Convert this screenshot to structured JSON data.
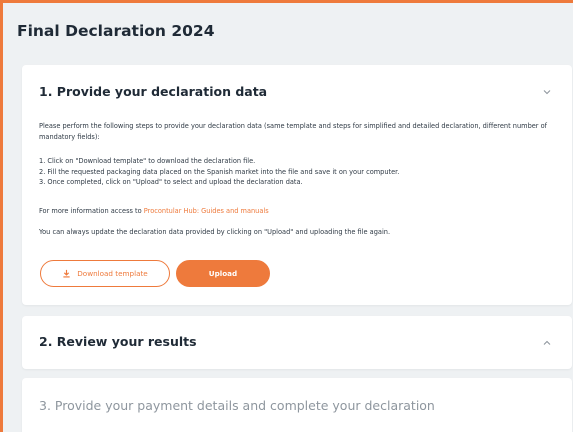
{
  "page": {
    "title": "Final Declaration 2024"
  },
  "colors": {
    "accent": "#ee7a3c",
    "background": "#eef1f3",
    "card": "#ffffff",
    "text": "#1f2a36",
    "muted": "#8e969e"
  },
  "step1": {
    "title": "1. Provide your declaration data",
    "intro": "Please perform the following steps to provide your declaration data (same template and steps for simplified and detailed declaration, different number of mandatory fields):",
    "steps": [
      "1. Click on \"Download template\" to download the declaration file.",
      "2. Fill the requested packaging data placed on the Spanish market into the file and save it on your computer.",
      "3. Once completed, click on \"Upload\" to select and upload the declaration data."
    ],
    "info_prefix": "For more information access to ",
    "info_link": "Procontular Hub: Guides and manuals",
    "update_note": "You can always update the declaration data provided by clicking on \"Upload\" and uploading the file again.",
    "download_label": "Download template",
    "upload_label": "Upload",
    "expand_icon": "chevron-down-icon"
  },
  "step2": {
    "title": "2. Review your results",
    "expand_icon": "chevron-up-icon"
  },
  "step3": {
    "title": "3. Provide your payment details and complete your declaration"
  }
}
